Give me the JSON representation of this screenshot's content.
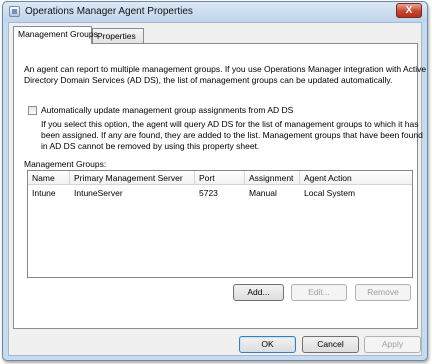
{
  "window": {
    "title": "Operations Manager Agent Properties",
    "close_label": "X"
  },
  "tabs": [
    {
      "label": "Management Groups",
      "active": true
    },
    {
      "label": "Properties",
      "active": false
    }
  ],
  "description": {
    "line1": "An agent can report to multiple management groups. If you use Operations Manager integration with Active",
    "line2": "Directory Domain Services (AD DS), the list of management groups can be updated automatically."
  },
  "auto_update": {
    "checked": false,
    "label": "Automatically update management group assignments from AD DS",
    "help_line1": "If you select this option, the agent will query AD DS for the list of management groups to which it has",
    "help_line2": "been assigned. If any are found, they are added to the list. Management groups that have been found",
    "help_line3": "in AD DS cannot be removed by using this property sheet."
  },
  "management_groups": {
    "label": "Management Groups:",
    "columns": [
      "Name",
      "Primary Management Server",
      "Port",
      "Assignment",
      "Agent Action"
    ],
    "rows": [
      [
        "Intune",
        "IntuneServer",
        "5723",
        "Manual",
        "Local System"
      ]
    ]
  },
  "list_buttons": {
    "add": "Add...",
    "edit": "Edit...",
    "remove": "Remove"
  },
  "dialog_buttons": {
    "ok": "OK",
    "cancel": "Cancel",
    "apply": "Apply"
  }
}
